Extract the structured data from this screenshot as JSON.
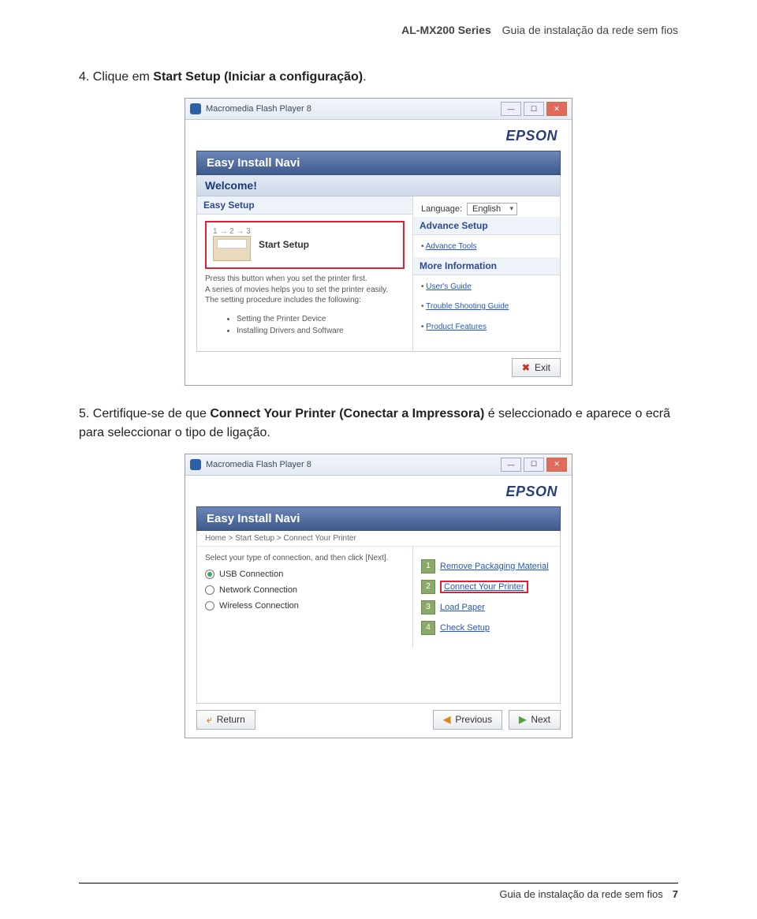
{
  "header": {
    "series": "AL-MX200 Series",
    "guide": "Guia de instalação da rede sem fios"
  },
  "step4": {
    "num": "4.",
    "before": "Clique em ",
    "bold1": "Start Setup (Iniciar a configuração)",
    "after": "."
  },
  "shot1": {
    "title": "Macromedia Flash Player 8",
    "brand": "EPSON",
    "navi": "Easy Install Navi",
    "welcome": "Welcome!",
    "easySetup": "Easy Setup",
    "steps123": "1 → 2 → 3",
    "startSetup": "Start Setup",
    "pressLine": "Press this button when you set the printer first.",
    "seriesLine": "A series of movies helps you to set the printer easily.",
    "procLine": "The setting procedure includes the following:",
    "proc1": "Setting the Printer Device",
    "proc2": "Installing Drivers and Software",
    "languageLabel": "Language:",
    "languageValue": "English",
    "advanceSetup": "Advance Setup",
    "advanceTools": "Advance Tools",
    "moreInfo": "More Information",
    "usersGuide": "User's Guide",
    "trouble": "Trouble Shooting Guide",
    "productFeatures": "Product Features",
    "exit": "Exit"
  },
  "step5": {
    "num": "5.",
    "before": "Certifique-se de que ",
    "bold1": "Connect Your Printer (Conectar a Impressora)",
    "after": " é seleccionado e aparece o ecrã para seleccionar o tipo de ligação."
  },
  "shot2": {
    "title": "Macromedia Flash Player 8",
    "brand": "EPSON",
    "navi": "Easy Install Navi",
    "crumbs": "Home > Start Setup > Connect Your Printer",
    "selectLine": "Select your type of connection, and then click [Next].",
    "optUSB": "USB Connection",
    "optNet": "Network Connection",
    "optWifi": "Wireless Connection",
    "s1": "Remove Packaging Material",
    "s2": "Connect Your Printer",
    "s3": "Load Paper",
    "s4": "Check Setup",
    "return": "Return",
    "previous": "Previous",
    "next": "Next"
  },
  "footer": {
    "guide": "Guia de instalação da rede sem fios",
    "page": "7"
  }
}
